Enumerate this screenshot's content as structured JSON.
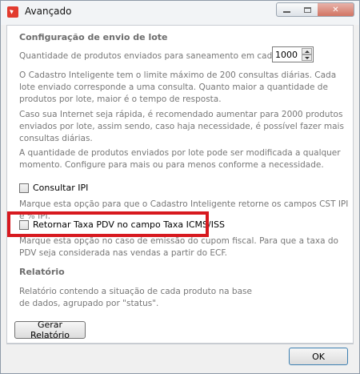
{
  "window": {
    "title": "Avançado"
  },
  "config": {
    "section_title": "Configuração de envio de lote",
    "qty_label": "Quantidade de produtos enviados para saneamento em cada lote:",
    "qty_value": "1000",
    "paragraph1": "O Cadastro Inteligente tem o limite máximo de 200 consultas diárias. Cada lote enviado corresponde a uma consulta. Quanto maior a quantidade de produtos por lote, maior é o tempo de resposta.",
    "paragraph2": "Caso sua Internet seja rápida, é recomendado aumentar para 2000 produtos enviados por lote, assim sendo, caso haja necessidade, é possível fazer mais consultas diárias.",
    "paragraph3": "A quantidade de produtos enviados por lote pode ser modificada a qualquer momento. Configure para mais ou para menos conforme a necessidade."
  },
  "options": {
    "ipi_label": "Consultar IPI",
    "ipi_checked": false,
    "ipi_hint": "Marque esta opção para que o Cadastro Inteligente retorne os campos CST IPI e % IPI.",
    "pdv_label": "Retornar Taxa PDV no campo Taxa ICMS/ISS",
    "pdv_checked": false,
    "pdv_hint": "Marque esta opção no caso de emissão do cupom fiscal. Para que a taxa do PDV seja considerada nas vendas a partir do ECF."
  },
  "report": {
    "section_title": "Relatório",
    "description": "Relatório contendo a situação de cada produto na base de dados, agrupado por \"status\".",
    "button_label": "Gerar Relatório"
  },
  "footer": {
    "ok_label": "OK"
  },
  "colors": {
    "highlight": "#d7191f",
    "close_button": "#d27463"
  }
}
